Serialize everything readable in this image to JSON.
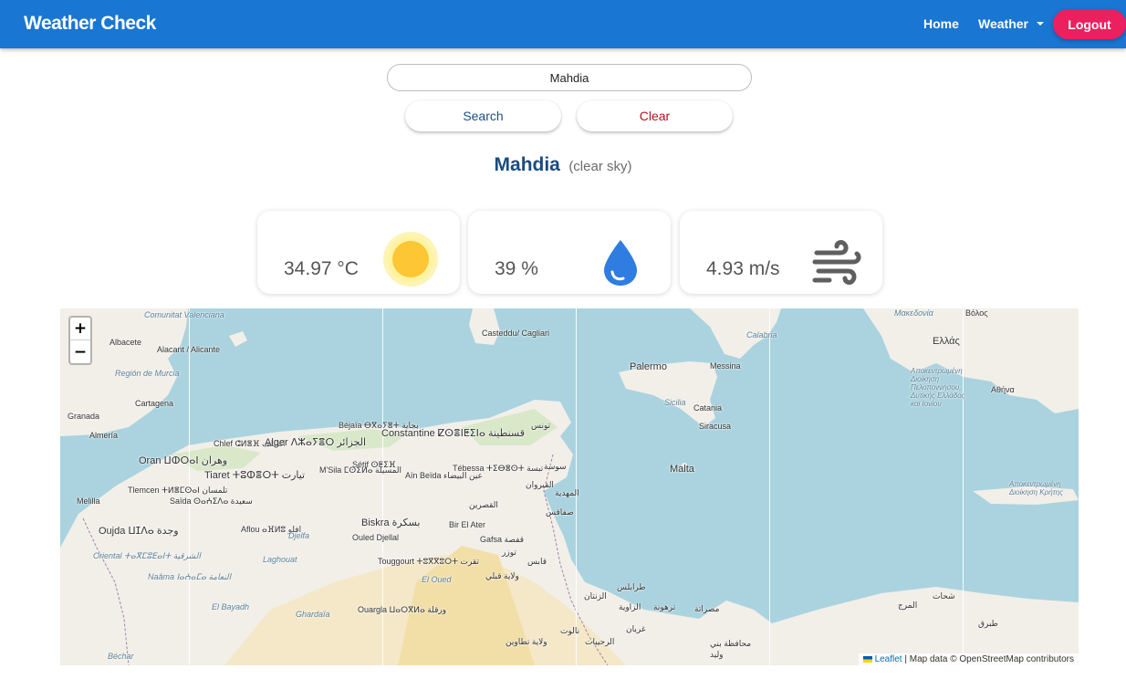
{
  "app": {
    "brand": "Weather Check"
  },
  "nav": {
    "home": "Home",
    "weather": "Weather",
    "logout": "Logout"
  },
  "search": {
    "value": "Mahdia",
    "search_label": "Search",
    "clear_label": "Clear"
  },
  "result": {
    "city": "Mahdia",
    "description": "(clear sky)"
  },
  "cards": {
    "temperature": {
      "value": "34.97 °C",
      "icon": "sun-icon"
    },
    "humidity": {
      "value": "39 %",
      "icon": "water-drop-icon"
    },
    "wind": {
      "value": "4.93 m/s",
      "icon": "wind-icon"
    }
  },
  "map": {
    "zoom_in": "+",
    "zoom_out": "−",
    "labels": {
      "comunitat": "Comunitat Valenciana",
      "albacete": "Albacete",
      "alacant": "Alacant / Alicante",
      "murcia": "Región de Murcia",
      "cartagena": "Cartagena",
      "granada": "Granada",
      "almeria": "Almería",
      "oran": "Oran ⵡⵀⵔⴰⵏ وهران",
      "chlef": "Chlef ⵛⵍⴻⴼ الشلف",
      "alger": "Alger ⴷⵣⴰⵢⴻⵔ الجزائر",
      "bejaia": "Béjaïa ⴱⴳⴰⵢⴻⵜ بجاية",
      "constantine": "Constantine ⵇⵙⴻⵏⵟⵉⵏⴰ قسنطينة",
      "setif": "Sétif ⵙⵟⵉⴼ",
      "tiaret": "Tiaret ⵜⵓⵀⴻⵔⵜ تيارت",
      "msila": "M'Sila ⵎⵙⵉⵍⴰ المسيلة",
      "ainbeida": "Aïn Beïda عين البيضاء",
      "tebessa": "Tébessa ⵜⵉⴱⴻⵙⵜ تبسة",
      "tlemcen": "Tlemcen ⵜⵍⴻⵎⵙⴰⵏ تلمسان",
      "saida": "Saïda ⵙⴰⵄⵉⴷⴰ سعيدة",
      "melilla": "Melilla",
      "oujda": "Oujda ⵡⵊⴷⴰ وجدة",
      "oriental": "Oriental ⵜⴰⴳⵎⵓⴹⴰⵏⵜ الشرقية",
      "naama": "Naâma ⵏⴰⵄⴰⵎⴰ النعامة",
      "aflou": "Aflou ⴰⴼⵍⵓ افلو",
      "laghouat": "Laghouat",
      "djelfa": "Djelfa",
      "biskra": "Biskra بسكرة",
      "ouled": "Ouled Djellal",
      "touggourt": "Touggourt ⵜⵓⴳⴳⵓⵔⵜ تقرت",
      "eloued": "El Oued",
      "gafsa": "Gafsa قفصة",
      "bir": "Bir El Ater",
      "kasserine": "القصرين",
      "kairouan": "القيروان",
      "sousse": "سوسة",
      "sfax": "صفاقس",
      "tunis": "تونس",
      "mahdia_ar": "المهدية",
      "tozeur": "توزر",
      "gabes": "قابس",
      "kebili": "ولاية قبلي",
      "tataouine": "ولاية تطاوين",
      "ghardaia": "Ghardaïa",
      "ouargla": "Ouargla ⵡⴰⵔⴳⵍⴰ ورقلة",
      "elbayadh": "El Bayadh",
      "bechar": "Béchar",
      "cagliari": "Casteddu/ Cagliari",
      "palermo": "Palermo",
      "messina": "Messina",
      "calabria": "Calabria",
      "sicilia": "Sicilia",
      "catania": "Catania",
      "siracusa": "Siracusa",
      "malta": "Malta",
      "makedonia": "Μακεδονία",
      "volos": "Βόλος",
      "ellada": "Ελλάς",
      "athina": "Αθήνα",
      "dytiki": "Αποκεντρωμένη Διοίκηση Πελοποννήσου, Δυτικής Ελλάδος και Ιονίου",
      "tripoli": "طرابلس",
      "zawiya": "الزاوية",
      "misrata": "مصراتة",
      "gharyan": "غريان",
      "tarhuna": "ترهونة",
      "nalut": "نالوت",
      "zintan": "الزنتان",
      "derna": "المرج",
      "benghazi": "شحات",
      "zliten": "وليد",
      "sirte": "محافظة بني",
      "sabha": "الرحيبات",
      "bayda": "طبرق",
      "kriti": "Αποκεντρωμένη Διοίκηση Κρήτης"
    },
    "attribution_leaflet": "Leaflet",
    "attribution_rest": " | Map data © OpenStreetMap contributors"
  },
  "colors": {
    "navbar": "#1976d2",
    "logout": "#ec1f5f",
    "city": "#1a4b82",
    "sea": "#aad3df",
    "land": "#f2efe9",
    "desert": "#f5e8c8",
    "sun": "#fcc634",
    "drop": "#2f7de1",
    "wind": "#5f5f5f"
  }
}
